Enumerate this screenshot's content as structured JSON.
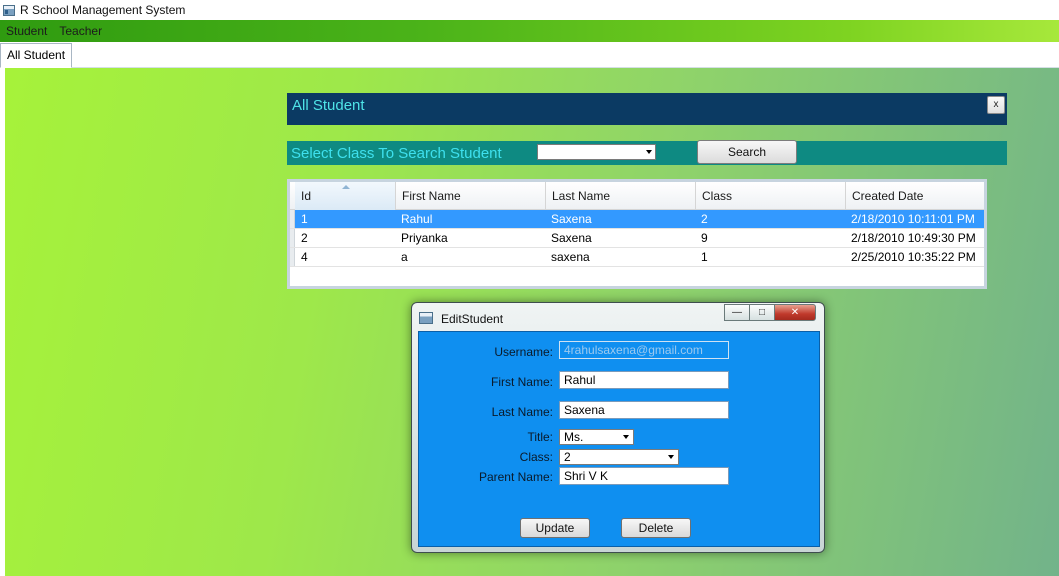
{
  "app": {
    "title": "R School Management System"
  },
  "menu": {
    "items": [
      "Student",
      "Teacher"
    ]
  },
  "tabs": [
    {
      "label": "All Student",
      "active": true
    }
  ],
  "panel": {
    "title": "All Student",
    "close_label": "x"
  },
  "search": {
    "label": "Select Class To Search Student",
    "selected": "",
    "button_label": "Search"
  },
  "grid": {
    "columns": [
      "Id",
      "First Name",
      "Last Name",
      "Class",
      "Created Date"
    ],
    "rows": [
      {
        "id": "1",
        "first": "Rahul",
        "last": "Saxena",
        "class": "2",
        "created": "2/18/2010 10:11:01 PM",
        "selected": true
      },
      {
        "id": "2",
        "first": "Priyanka",
        "last": "Saxena",
        "class": "9",
        "created": "2/18/2010 10:49:30 PM",
        "selected": false
      },
      {
        "id": "4",
        "first": "a",
        "last": "saxena",
        "class": "1",
        "created": "2/25/2010 10:35:22 PM",
        "selected": false
      }
    ]
  },
  "dialog": {
    "title": "EditStudent",
    "fields": {
      "username": {
        "label": "Username:",
        "value": "4rahulsaxena@gmail.com"
      },
      "first_name": {
        "label": "First Name:",
        "value": "Rahul"
      },
      "last_name": {
        "label": "Last Name:",
        "value": "Saxena"
      },
      "title": {
        "label": "Title:",
        "value": "Ms."
      },
      "class": {
        "label": "Class:",
        "value": "2"
      },
      "parent_name": {
        "label": "Parent Name:",
        "value": "Shri V K"
      }
    },
    "buttons": {
      "update": "Update",
      "delete": "Delete"
    }
  },
  "colors": {
    "menubar": "#4bb319",
    "panel_header": "#0b3a63",
    "search_bar": "#0e8a82",
    "selection": "#3399ff",
    "dialog_body": "#0f8ff0"
  }
}
